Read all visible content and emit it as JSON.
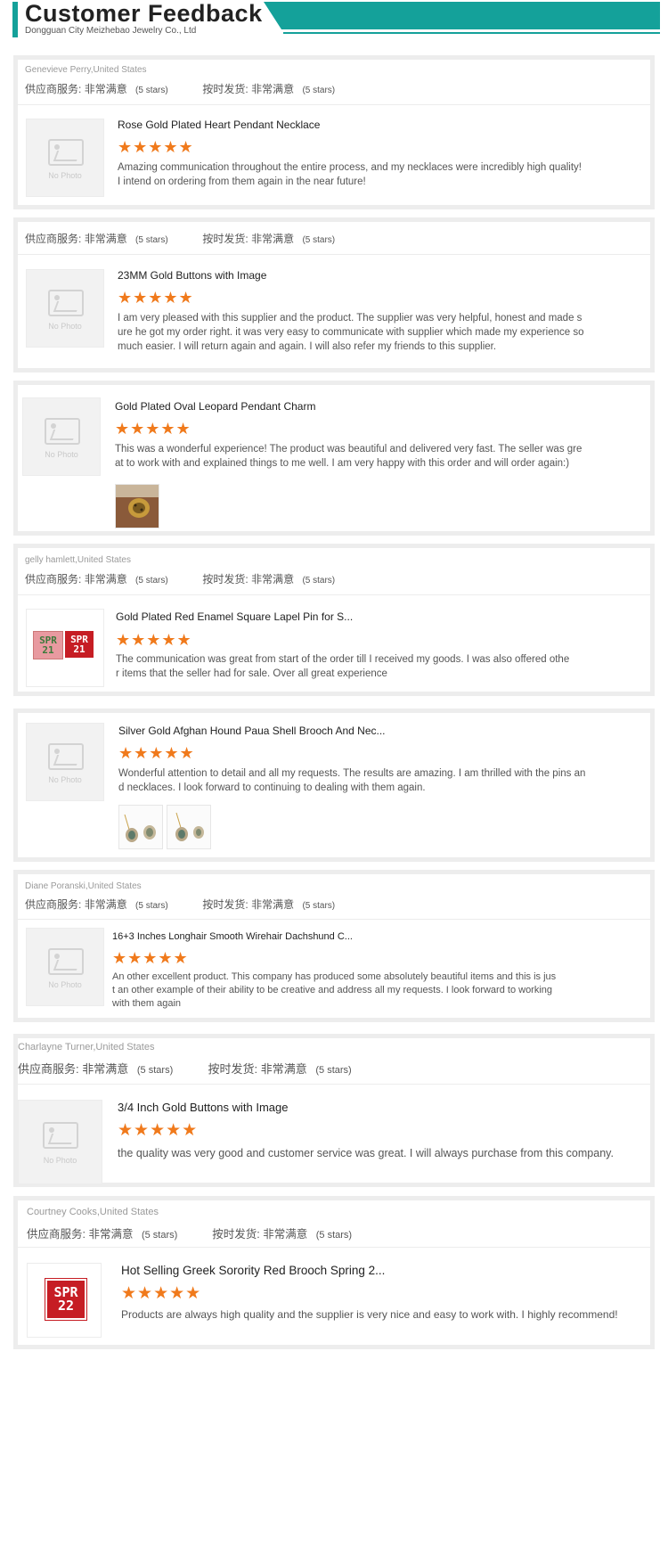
{
  "header": {
    "title": "Customer Feedback",
    "subtitle": "Dongguan City Meizhebao Jewelry Co., Ltd",
    "accent_color": "#14a19a"
  },
  "labels": {
    "supplier_service": "供应商服务:",
    "on_time_delivery": "按时发货:",
    "rating_value": "非常满意",
    "rating_stars": "(5 stars)",
    "no_photo": "No Photo",
    "stars_glyph": "★★★★★"
  },
  "reviews": [
    {
      "reviewer": "Genevieve Perry,United States",
      "product": "Rose Gold Plated Heart Pendant Necklace",
      "rating": 5,
      "text": "Amazing communication throughout the entire process, and my necklaces were incredibly high quality! I intend on ordering from them again in the near future!"
    },
    {
      "reviewer": "",
      "product": "23MM Gold Buttons with Image",
      "rating": 5,
      "text": "I am very pleased with this supplier and the product. The supplier was very helpful, honest and made sure he got my order right. it was very easy to communicate with supplier which made my experience so much easier. I will return again and again. I will also refer my friends to this supplier."
    },
    {
      "reviewer": "",
      "product": "Gold Plated Oval Leopard Pendant Charm",
      "rating": 5,
      "text": "This was a wonderful experience!  The product was beautiful and delivered very fast.  The seller was great to work with and explained things to me well.  I am very happy with this order and will order again:)"
    },
    {
      "reviewer": "gelly hamlett,United States",
      "product": "Gold Plated Red Enamel Square Lapel Pin for S...",
      "rating": 5,
      "text": "The communication was great from start of the order till I received my goods. I was also offered other items that the seller had for sale. Over all great experience",
      "thumb_text": [
        "SPR",
        "21",
        "SPR",
        "21"
      ]
    },
    {
      "reviewer": "",
      "product": "Silver Gold Afghan Hound Paua Shell Brooch And Nec...",
      "rating": 5,
      "text": "Wonderful attention to detail and all my requests. The results are amazing. I am thrilled with the pins and necklaces. I look forward to continuing to dealing with them again."
    },
    {
      "reviewer": "Diane Poranski,United States",
      "product": "16+3 Inches Longhair Smooth Wirehair Dachshund C...",
      "rating": 5,
      "text": "An other excellent product. This company has produced some absolutely beautiful items and this is just an other example of their ability to be creative and address all my requests. I look forward to working with them again"
    },
    {
      "reviewer": "Charlayne Turner,United States",
      "product": "3/4 Inch Gold Buttons with Image",
      "rating": 5,
      "text": "the quality was very good and customer service was great. I will always purchase from this company."
    },
    {
      "reviewer": "Courtney Cooks,United States",
      "product": "Hot Selling Greek Sorority Red Brooch Spring 2...",
      "rating": 5,
      "text": "Products are always high quality and the supplier is very nice and easy to work with. I highly recommend!",
      "thumb_text": [
        "SPR",
        "22"
      ]
    }
  ]
}
